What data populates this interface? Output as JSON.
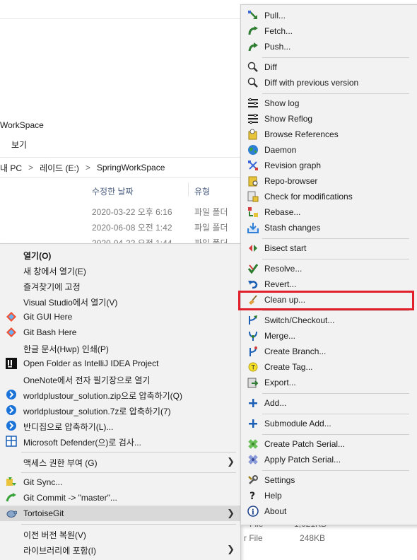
{
  "explorer": {
    "window_title": "WorkSpace",
    "menu_label": "보기",
    "breadcrumb": [
      "내 PC",
      ">",
      "레이드 (E:)",
      ">",
      "SpringWorkSpace"
    ],
    "columns": [
      "수정한 날짜",
      "유형"
    ],
    "rows": [
      {
        "date": "2020-03-22 오후 6:16",
        "type": "파일 폴더"
      },
      {
        "date": "2020-06-08 오전 1:42",
        "type": "파일 폴더"
      },
      {
        "date": "2020-04-22 오전 1:44",
        "type": "파일 폴더"
      }
    ],
    "bottom_rows": [
      {
        "name": "File",
        "size": "1,021KB"
      },
      {
        "name": "r File",
        "size": "248KB"
      }
    ]
  },
  "context_menu": {
    "items": [
      {
        "label": "열기(O)",
        "icon": "none"
      },
      {
        "label": "새 창에서 열기(E)",
        "icon": "none"
      },
      {
        "label": "즐겨찾기에 고정",
        "icon": "none"
      },
      {
        "label": "Visual Studio에서 열기(V)",
        "icon": "none"
      },
      {
        "label": "Git GUI Here",
        "icon": "git-diamond-icon"
      },
      {
        "label": "Git Bash Here",
        "icon": "git-diamond-icon"
      },
      {
        "label": "한글 문서(Hwp) 인쇄(P)",
        "icon": "none"
      },
      {
        "label": "Open Folder as IntelliJ IDEA Project",
        "icon": "intellij-icon"
      },
      {
        "label": "OneNote에서 전자 필기장으로 열기",
        "icon": "none"
      },
      {
        "label": "worldplustour_solution.zip으로 압축하기(Q)",
        "icon": "bandizip-icon"
      },
      {
        "label": "worldplustour_solution.7z로 압축하기(7)",
        "icon": "bandizip-icon"
      },
      {
        "label": "반디집으로 압축하기(L)...",
        "icon": "bandizip-icon"
      },
      {
        "label": "Microsoft Defender(으)로 검사...",
        "icon": "defender-icon"
      },
      {
        "label": "액세스 권한 부여 (G)",
        "icon": "none"
      },
      {
        "label": "Git Sync...",
        "icon": "git-sync-icon"
      },
      {
        "label": "Git Commit -> \"master\"...",
        "icon": "git-commit-icon"
      },
      {
        "label": "TortoiseGit",
        "icon": "tortoise-icon"
      },
      {
        "label": "이전 버전 복원(V)",
        "icon": "none"
      },
      {
        "label": "라이브러리에 포함(I)",
        "icon": "none"
      }
    ]
  },
  "tortoise_menu": {
    "items": [
      {
        "label": "Pull...",
        "icon": "pull-icon"
      },
      {
        "label": "Fetch...",
        "icon": "fetch-icon"
      },
      {
        "label": "Push...",
        "icon": "push-icon"
      },
      {
        "label": "Diff",
        "icon": "diff-icon"
      },
      {
        "label": "Diff with previous version",
        "icon": "diff-icon"
      },
      {
        "label": "Show log",
        "icon": "log-icon"
      },
      {
        "label": "Show Reflog",
        "icon": "log-icon"
      },
      {
        "label": "Browse References",
        "icon": "references-icon"
      },
      {
        "label": "Daemon",
        "icon": "globe-icon"
      },
      {
        "label": "Revision graph",
        "icon": "graph-icon"
      },
      {
        "label": "Repo-browser",
        "icon": "repo-browser-icon"
      },
      {
        "label": "Check for modifications",
        "icon": "check-modifications-icon"
      },
      {
        "label": "Rebase...",
        "icon": "rebase-icon"
      },
      {
        "label": "Stash changes",
        "icon": "stash-icon"
      },
      {
        "label": "Bisect start",
        "icon": "bisect-icon"
      },
      {
        "label": "Resolve...",
        "icon": "resolve-icon"
      },
      {
        "label": "Revert...",
        "icon": "revert-icon"
      },
      {
        "label": "Clean up...",
        "icon": "broom-icon"
      },
      {
        "label": "Switch/Checkout...",
        "icon": "switch-icon"
      },
      {
        "label": "Merge...",
        "icon": "merge-icon"
      },
      {
        "label": "Create Branch...",
        "icon": "branch-icon"
      },
      {
        "label": "Create Tag...",
        "icon": "tag-icon"
      },
      {
        "label": "Export...",
        "icon": "export-icon"
      },
      {
        "label": "Add...",
        "icon": "plus-icon"
      },
      {
        "label": "Submodule Add...",
        "icon": "plus-icon"
      },
      {
        "label": "Create Patch Serial...",
        "icon": "patch-icon"
      },
      {
        "label": "Apply Patch Serial...",
        "icon": "patch-icon"
      },
      {
        "label": "Settings",
        "icon": "settings-icon"
      },
      {
        "label": "Help",
        "icon": "help-icon"
      },
      {
        "label": "About",
        "icon": "info-icon"
      }
    ],
    "highlighted": "Clean up..."
  },
  "colors": {
    "menu_bg": "#f2f2f2",
    "hover_bg": "#d9d9d9",
    "highlight_frame": "#e0202a",
    "separator": "#cfcfcf"
  }
}
